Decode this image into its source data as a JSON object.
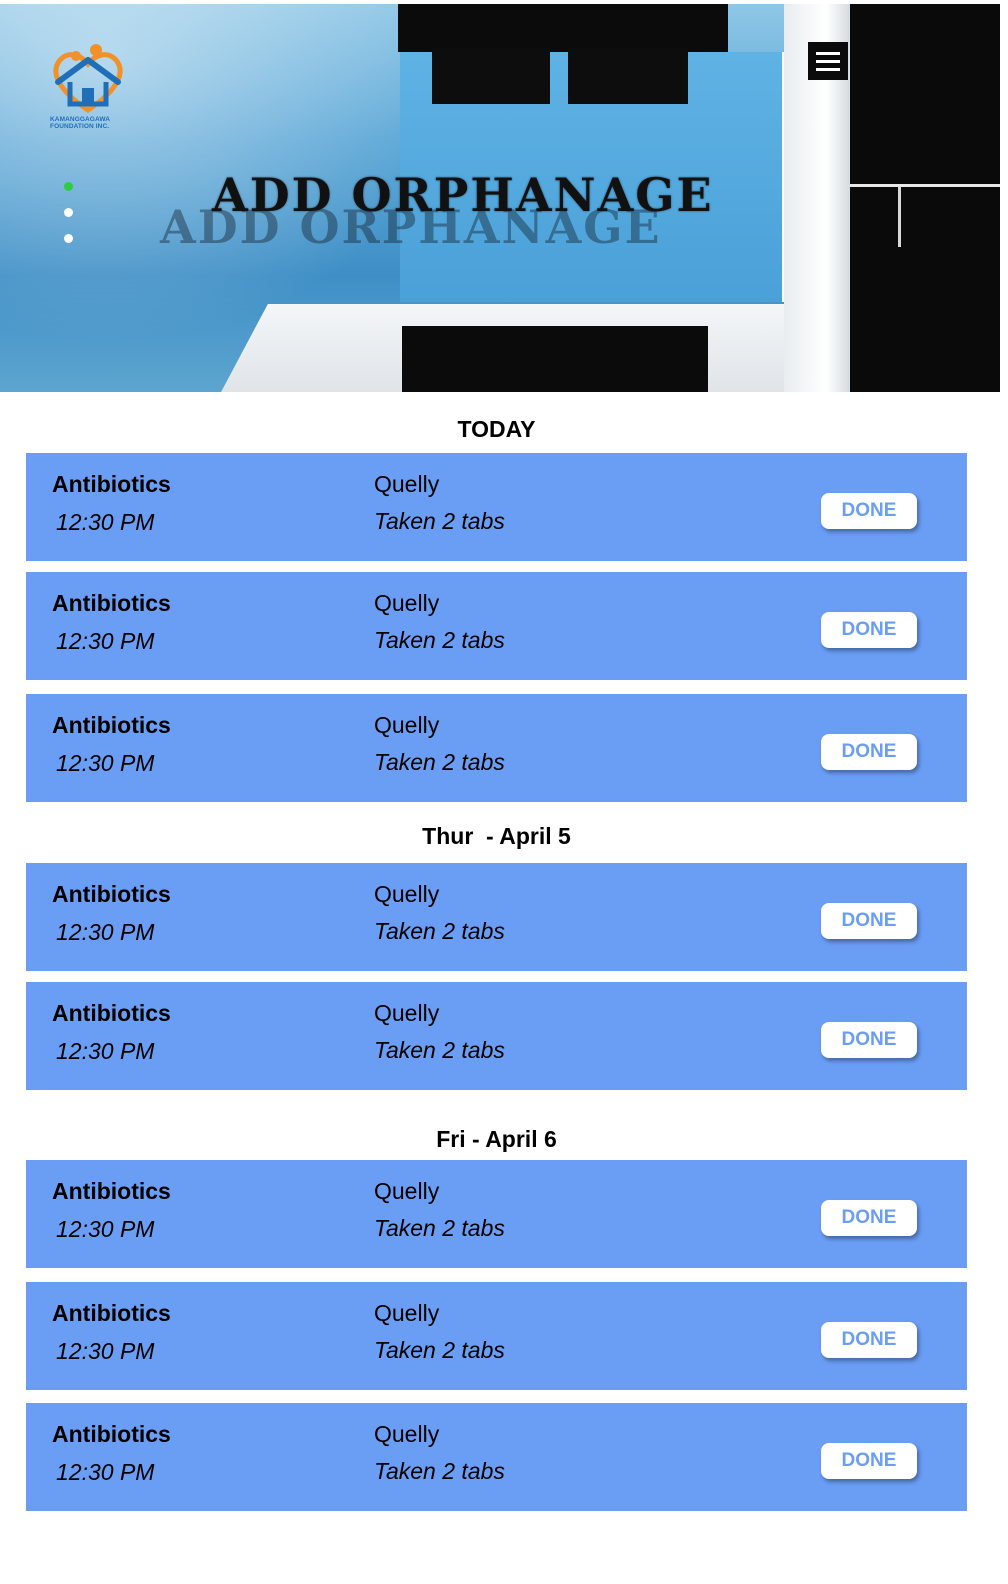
{
  "header": {
    "title": "ADD ORPHANAGE",
    "logo_text": "KAMANGGAGAWA FOUNDATION INC.",
    "menu_icon": "hamburger-menu-icon",
    "slide_count": 3,
    "active_slide": 1
  },
  "colors": {
    "card_background": "#6a9ef5",
    "done_text": "#6a9ef5",
    "active_dot": "#2ecc40",
    "logo_orange": "#f0912a",
    "logo_blue": "#1f6fb8"
  },
  "sections": [
    {
      "heading": "TODAY",
      "items": [
        {
          "medicine": "Antibiotics",
          "time": "12:30 PM",
          "patient": "Quelly",
          "dose": "Taken 2 tabs",
          "button": "DONE"
        },
        {
          "medicine": "Antibiotics",
          "time": "12:30 PM",
          "patient": "Quelly",
          "dose": "Taken 2 tabs",
          "button": "DONE"
        },
        {
          "medicine": "Antibiotics",
          "time": "12:30 PM",
          "patient": "Quelly",
          "dose": "Taken 2 tabs",
          "button": "DONE"
        }
      ]
    },
    {
      "heading": "Thur  - April 5",
      "items": [
        {
          "medicine": "Antibiotics",
          "time": "12:30 PM",
          "patient": "Quelly",
          "dose": "Taken 2 tabs",
          "button": "DONE"
        },
        {
          "medicine": "Antibiotics",
          "time": "12:30 PM",
          "patient": "Quelly",
          "dose": "Taken 2 tabs",
          "button": "DONE"
        }
      ]
    },
    {
      "heading": "Fri - April 6",
      "items": [
        {
          "medicine": "Antibiotics",
          "time": "12:30 PM",
          "patient": "Quelly",
          "dose": "Taken 2 tabs",
          "button": "DONE"
        },
        {
          "medicine": "Antibiotics",
          "time": "12:30 PM",
          "patient": "Quelly",
          "dose": "Taken 2 tabs",
          "button": "DONE"
        },
        {
          "medicine": "Antibiotics",
          "time": "12:30 PM",
          "patient": "Quelly",
          "dose": "Taken 2 tabs",
          "button": "DONE"
        }
      ]
    }
  ]
}
